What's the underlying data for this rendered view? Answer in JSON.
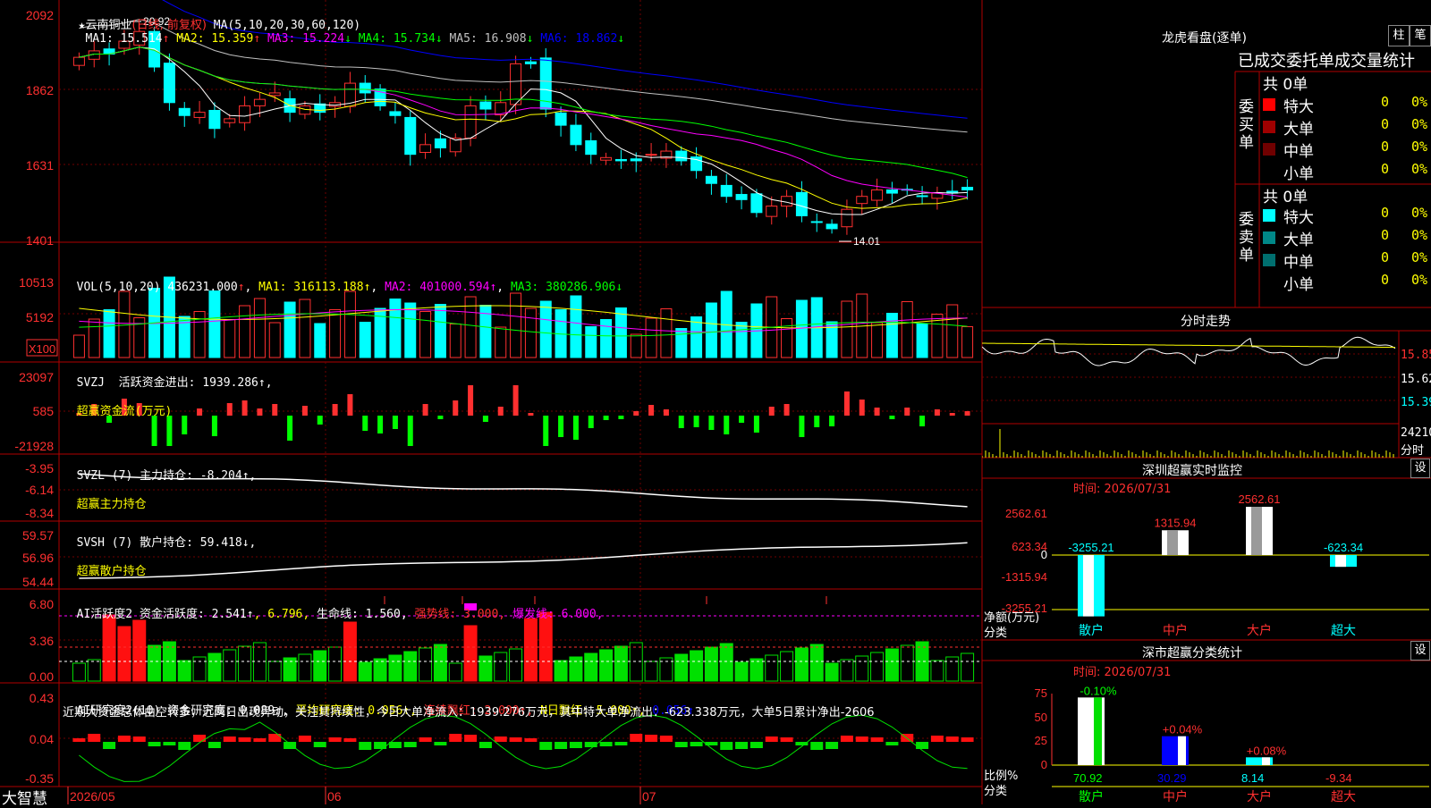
{
  "app": {
    "name": "大智慧"
  },
  "main_chart": {
    "star": "★",
    "stock_name": "云南铜业",
    "period": "(日线, 前复权)",
    "ma_params": "MA(5,10,20,30,60,120)",
    "ma_values": [
      {
        "label": "MA1:",
        "value": "15.514",
        "arrow": "↑",
        "color": "#ffffff"
      },
      {
        "label": "MA2:",
        "value": "15.359",
        "arrow": "↑",
        "color": "#ffff00"
      },
      {
        "label": "MA3:",
        "value": "15.224",
        "arrow": "↓",
        "color": "#ff00ff"
      },
      {
        "label": "MA4:",
        "value": "15.734",
        "arrow": "↓",
        "color": "#00ff00"
      },
      {
        "label": "MA5:",
        "value": "16.908",
        "arrow": "↓",
        "color": "#c0c0c0"
      },
      {
        "label": "MA6:",
        "value": "18.862",
        "arrow": "↓",
        "color": "#0000ff"
      }
    ],
    "high_marker": "20.92",
    "low_marker": "14.01",
    "y_ticks": [
      "2092",
      "1862",
      "1631",
      "1401"
    ]
  },
  "volume": {
    "header": "VOL(5,10,20)",
    "value": "436231.000",
    "ma1": "MA1: 316113.188↑",
    "ma2": "MA2: 401000.594↑",
    "ma3": "MA3: 380286.906↓",
    "y_ticks": [
      "10513",
      "5192"
    ],
    "unit": "X100"
  },
  "svzj": {
    "header": "SVZJ  活跃资金进出: 1939.286↑,",
    "sub": "超赢资金流(万元)",
    "y_ticks": [
      "23097",
      "585",
      "-21928"
    ]
  },
  "svzl": {
    "header": "SVZL (7) 主力持仓: -8.204↑,",
    "sub": "超赢主力持仓",
    "y_ticks": [
      "-3.95",
      "-6.14",
      "-8.34"
    ]
  },
  "svsh": {
    "header": "SVSH (7) 散户持仓: 59.418↓,",
    "sub": "超赢散户持仓",
    "y_ticks": [
      "59.57",
      "56.96",
      "54.44"
    ]
  },
  "ai_active": {
    "header_1": "AI活跃度2 资金活跃度: 2.541↑",
    "header_2": ", 6.796, ",
    "header_3": "生命线: 1.560, ",
    "header_4": "强势线: 3.000, ",
    "header_5": "爆发线: 6.000,",
    "y_ticks": [
      "6.80",
      "3.36",
      "0.00"
    ]
  },
  "ai_research": {
    "header_1": "AI研究度2(10) 资金研究度: 0.089↑, ",
    "header_2": "平均研究度: 0.056↑, ",
    "header_3": "连续飘红: 2.000↑, ",
    "header_4": "N日飘红: 5.000↑, ",
    "header_5": "0.056↑",
    "comment": "近期大资金总体由空转多，近两日出现异动，关注其持续性，今日大单净流入：1939.276万元，其中特大单净流出：-623.338万元，大单5日累计净出-2606",
    "y_ticks": [
      "0.43",
      "0.04",
      "-0.35"
    ]
  },
  "x_axis": {
    "labels": [
      "2026/05",
      "06",
      "07"
    ]
  },
  "right_panel": {
    "title": "龙虎看盘(逐单)",
    "btn_zhu": "柱",
    "btn_bi": "笔",
    "stats_title": "已成交委托单成交量统计",
    "buy_label": "委买单",
    "sell_label": "委卖单",
    "buy_total": "共 0单",
    "sell_total": "共 0单",
    "buy_rows": [
      {
        "name": "特大",
        "count": "0",
        "pct": "0%",
        "color": "#ff0000"
      },
      {
        "name": "大单",
        "count": "0",
        "pct": "0%",
        "color": "#a00000"
      },
      {
        "name": "中单",
        "count": "0",
        "pct": "0%",
        "color": "#700000"
      },
      {
        "name": "小单",
        "count": "0",
        "pct": "0%",
        "color": ""
      }
    ],
    "sell_rows": [
      {
        "name": "特大",
        "count": "0",
        "pct": "0%",
        "color": "#00ffff"
      },
      {
        "name": "大单",
        "count": "0",
        "pct": "0%",
        "color": "#008888"
      },
      {
        "name": "中单",
        "count": "0",
        "pct": "0%",
        "color": "#006f6f"
      },
      {
        "name": "小单",
        "count": "0",
        "pct": "0%",
        "color": ""
      }
    ],
    "intraday": {
      "title": "分时走势",
      "y_ticks": [
        "15.85",
        "15.62",
        "15.39"
      ],
      "vol_tick": "24210",
      "unit": "分时"
    },
    "monitor": {
      "title": "深圳超赢实时监控",
      "set_btn": "设",
      "time": "时间: 2026/07/31",
      "y_ticks": [
        "2562.61",
        "623.34",
        "0",
        "-1315.94",
        "-3255.21"
      ],
      "y_label_1": "净额(万元)",
      "y_label_2": "分类",
      "categories": [
        "散户",
        "中户",
        "大户",
        "超大"
      ],
      "values": [
        "-3255.21",
        "1315.94",
        "2562.61",
        "-623.34"
      ]
    },
    "classify": {
      "title": "深市超赢分类统计",
      "set_btn": "设",
      "time": "时间: 2026/07/31",
      "y_ticks": [
        "75",
        "50",
        "25",
        "0"
      ],
      "y_label_1": "比例%",
      "y_label_2": "分类",
      "categories": [
        "散户",
        "中户",
        "大户",
        "超大"
      ],
      "bar_labels": [
        "-0.10%",
        "+0.04%",
        "+0.08%",
        ""
      ],
      "bottom_values": [
        "70.92",
        "30.29",
        "8.14",
        "-9.34"
      ]
    }
  },
  "chart_data": [
    {
      "type": "candlestick",
      "title": "云南铜业 (日线, 前复权)",
      "ylim": [
        14.01,
        20.92
      ],
      "close": [
        19.7,
        19.9,
        19.8,
        20.2,
        20.5,
        19.4,
        18.3,
        17.9,
        18.0,
        17.5,
        17.8,
        18.2,
        18.4,
        18.6,
        18.0,
        18.2,
        18.0,
        18.3,
        18.9,
        18.6,
        18.2,
        17.9,
        16.7,
        17.0,
        16.9,
        17.2,
        18.2,
        18.1,
        18.3,
        19.5,
        19.5,
        18.1,
        17.6,
        17.0,
        16.7,
        16.6,
        16.5,
        16.5,
        16.7,
        16.8,
        16.5,
        16.2,
        15.8,
        15.4,
        15.3,
        14.9,
        15.1,
        15.4,
        14.8,
        14.6,
        14.4,
        15.0,
        15.4,
        15.6,
        15.5,
        15.6,
        15.4,
        15.5,
        15.5,
        15.6
      ]
    }
  ]
}
